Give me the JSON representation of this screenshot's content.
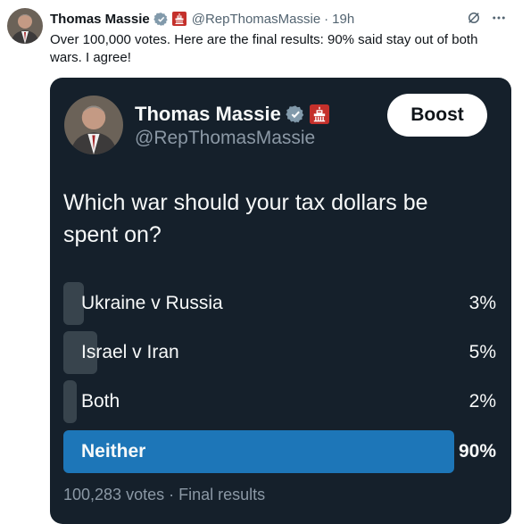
{
  "tweet": {
    "author_name": "Thomas Massie",
    "author_handle": "@RepThomasMassie",
    "separator": "·",
    "time": "19h",
    "text": "Over 100,000 votes. Here are the final results: 90% said stay out of both wars. I agree!"
  },
  "card": {
    "author_name": "Thomas Massie",
    "author_handle": "@RepThomasMassie",
    "boost_label": "Boost",
    "question": "Which war should your tax dollars be spent on?",
    "options": [
      {
        "label": "Ukraine v Russia",
        "percent_text": "3%",
        "percent": 3,
        "winner": false
      },
      {
        "label": "Israel v Iran",
        "percent_text": "5%",
        "percent": 5,
        "winner": false
      },
      {
        "label": "Both",
        "percent_text": "2%",
        "percent": 2,
        "winner": false
      },
      {
        "label": "Neither",
        "percent_text": "90%",
        "percent": 90,
        "winner": true
      }
    ],
    "votes_text": "100,283 votes",
    "separator": "·",
    "status_text": "Final results"
  },
  "colors": {
    "card_bg": "#15202b",
    "bar_default": "#38444d",
    "bar_winner": "#1d76b8",
    "verified_badge": "#829aab",
    "congress_badge": "#c4302b"
  },
  "icons": [
    "verified-badge-icon",
    "congress-badge-icon",
    "grok-icon",
    "more-icon"
  ]
}
